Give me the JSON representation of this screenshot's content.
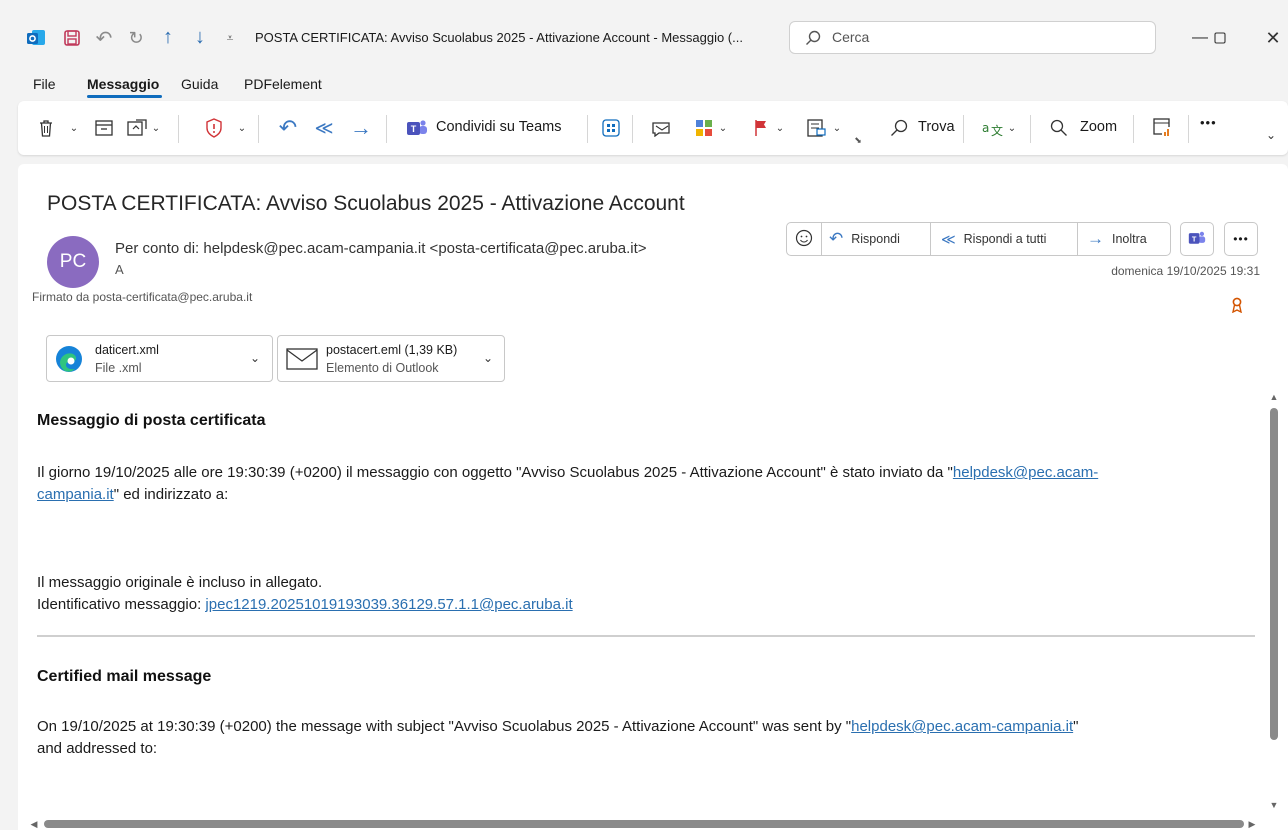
{
  "window": {
    "title": "POSTA CERTIFICATA: Avviso Scuolabus 2025 - Attivazione Account  -  Messaggio (...",
    "search_placeholder": "Cerca"
  },
  "menu": {
    "tabs": [
      {
        "label": "File"
      },
      {
        "label": "Messaggio"
      },
      {
        "label": "Guida"
      },
      {
        "label": "PDFelement"
      }
    ]
  },
  "ribbon": {
    "share_teams_label": "Condividi su Teams",
    "find_label": "Trova",
    "zoom_label": "Zoom",
    "more_label": "•••"
  },
  "message": {
    "subject": "POSTA CERTIFICATA: Avviso Scuolabus 2025 - Attivazione Account",
    "avatar_initials": "PC",
    "from": "Per conto di: helpdesk@pec.acam-campania.it <posta-certificata@pec.aruba.it>",
    "to_label": "A",
    "signed_by": "Firmato da   posta-certificata@pec.aruba.it",
    "date": "domenica 19/10/2025 19:31",
    "actions": {
      "reply": "Rispondi",
      "reply_all": "Rispondi a tutti",
      "forward": "Inoltra"
    }
  },
  "attachments": [
    {
      "name": "daticert.xml",
      "type": "File .xml"
    },
    {
      "name": "postacert.eml (1,39 KB)",
      "type": "Elemento di Outlook"
    }
  ],
  "body": {
    "it_heading": "Messaggio di posta certificata",
    "it_p1_a": "Il giorno 19/10/2025 alle ore 19:30:39 (+0200) il messaggio con oggetto \"Avviso Scuolabus 2025 - Attivazione Account\" è stato inviato da \"",
    "it_p1_link_a": "helpdesk@pec.acam-",
    "it_p1_link_b": "campania.it",
    "it_p1_b": "\" ed indirizzato a:",
    "it_p2": "Il messaggio originale è incluso in allegato.",
    "it_p3_label": "Identificativo messaggio: ",
    "it_p3_link": "jpec1219.20251019193039.36129.57.1.1@pec.aruba.it",
    "en_heading": "Certified mail message",
    "en_p1_a": "On 19/10/2025 at 19:30:39 (+0200) the message with subject \"Avviso Scuolabus 2025 - Attivazione Account\" was sent by \"",
    "en_p1_link": "helpdesk@pec.acam-campania.it",
    "en_p1_b": "\"",
    "en_p1_c": "and addressed to:"
  },
  "colors": {
    "accent": "#0f6cbd",
    "avatar": "#8a6bc0",
    "link": "#2a6fb0",
    "flag": "#d13438"
  }
}
